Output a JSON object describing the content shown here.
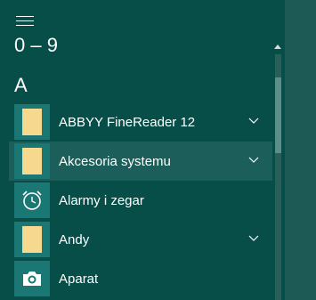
{
  "start_menu": {
    "menu_button_label": "",
    "groups": [
      {
        "header": "0 – 9"
      },
      {
        "header": "A"
      }
    ],
    "items": [
      {
        "label": "ABBYY FineReader 12",
        "icon": "folder-icon",
        "expandable": true,
        "highlighted": false
      },
      {
        "label": "Akcesoria systemu",
        "icon": "folder-icon",
        "expandable": true,
        "highlighted": true
      },
      {
        "label": "Alarmy i zegar",
        "icon": "alarm-clock-icon",
        "expandable": false,
        "highlighted": false
      },
      {
        "label": "Andy",
        "icon": "folder-icon",
        "expandable": true,
        "highlighted": false
      },
      {
        "label": "Aparat",
        "icon": "camera-icon",
        "expandable": false,
        "highlighted": false
      }
    ]
  },
  "colors": {
    "menu_background": "#074e49",
    "tile_background": "#1b7773",
    "highlight_background": "#1c5e5a",
    "folder_color": "#f6d98e"
  }
}
